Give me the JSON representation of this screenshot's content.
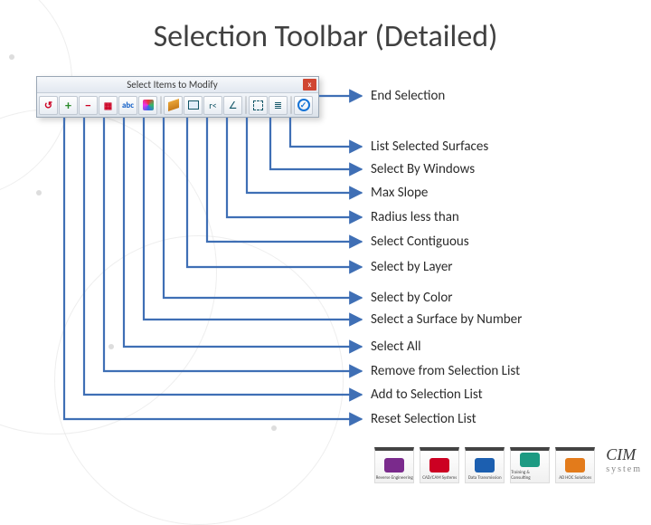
{
  "title": "Selection Toolbar (Detailed)",
  "window": {
    "title": "Select Items to Modify",
    "close": "x"
  },
  "icons": {
    "reset": {
      "name": "reset-selection-list-icon",
      "int": "true",
      "label": "Reset Selection List"
    },
    "add": {
      "name": "add-to-selection-icon",
      "int": "true",
      "label": "Add to Selection List"
    },
    "remove": {
      "name": "remove-from-selection-icon",
      "int": "true",
      "label": "Remove from Selection List"
    },
    "all": {
      "name": "select-all-icon",
      "int": "true",
      "label": "Select All"
    },
    "num": {
      "name": "select-by-number-icon",
      "int": "true",
      "label": "Select a Surface by Number"
    },
    "color": {
      "name": "select-by-color-icon",
      "int": "true",
      "label": "Select by Color"
    },
    "layer": {
      "name": "select-by-layer-icon",
      "int": "true",
      "label": "Select by Layer"
    },
    "contig": {
      "name": "select-contiguous-icon",
      "int": "true",
      "label": "Select Contiguous"
    },
    "radius": {
      "name": "radius-less-than-icon",
      "int": "true",
      "label": "Radius less than"
    },
    "slope": {
      "name": "max-slope-icon",
      "int": "true",
      "label": "Max Slope"
    },
    "winsel": {
      "name": "select-by-windows-icon",
      "int": "true",
      "label": "Select By Windows"
    },
    "list": {
      "name": "list-selected-surfaces-icon",
      "int": "true",
      "label": "List Selected Surfaces"
    },
    "end": {
      "name": "end-selection-icon",
      "int": "true",
      "label": "End Selection"
    }
  },
  "footer": {
    "items": [
      "Reverse Engineering",
      "CAD/CAM Systems",
      "Data Transmission",
      "Training & Consulting",
      "AD HOC Solutions"
    ],
    "brand": "CIM",
    "brand_sub": "system"
  },
  "colors": {
    "arrow": "#3f6fb5"
  }
}
